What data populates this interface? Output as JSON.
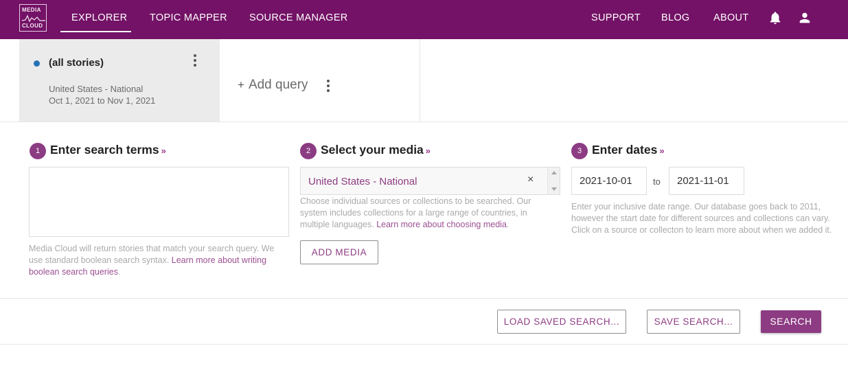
{
  "brand": {
    "logo_line1": "MEDIA",
    "logo_line2": "CLOUD"
  },
  "nav": {
    "left": [
      "EXPLORER",
      "TOPIC MAPPER",
      "SOURCE MANAGER"
    ],
    "active": "EXPLORER",
    "right": [
      "SUPPORT",
      "BLOG",
      "ABOUT"
    ],
    "icons": [
      "bell-icon",
      "user-icon"
    ]
  },
  "query": {
    "title": "(all stories)",
    "collection": "United States - National",
    "date_range": "Oct 1, 2021 to Nov 1, 2021",
    "color": "#2672b8"
  },
  "add_query": {
    "plus": "+",
    "label": "Add query"
  },
  "steps": {
    "terms": {
      "number": "1",
      "title": "Enter search terms",
      "help_text": "Media Cloud will return stories that match your search query. We use standard boolean search syntax. ",
      "help_link": "Learn more about writing boolean search queries",
      "help_end": "."
    },
    "media": {
      "number": "2",
      "title": "Select your media",
      "selected": "United States - National",
      "remove_glyph": "×",
      "help_text": "Choose individual sources or collections to be searched. Our system includes collections for a large range of countries, in multiple languages. ",
      "help_link": "Learn more about choosing media",
      "help_end": ".",
      "add_button": "ADD MEDIA"
    },
    "dates": {
      "number": "3",
      "title": "Enter dates",
      "start": "2021-10-01",
      "separator": "to",
      "end": "2021-11-01",
      "help_text": "Enter your inclusive date range. Our database goes back to 2011, however the start date for different sources and collections can vary. Click on a source or collecton to learn more about when we added it."
    },
    "raquo": "»"
  },
  "actions": {
    "load": "LOAD SAVED SEARCH...",
    "save": "SAVE SEARCH...",
    "search": "SEARCH"
  },
  "colors": {
    "topbar": "#731266",
    "accent": "#8d3c83",
    "query_dot": "#2672b8"
  }
}
